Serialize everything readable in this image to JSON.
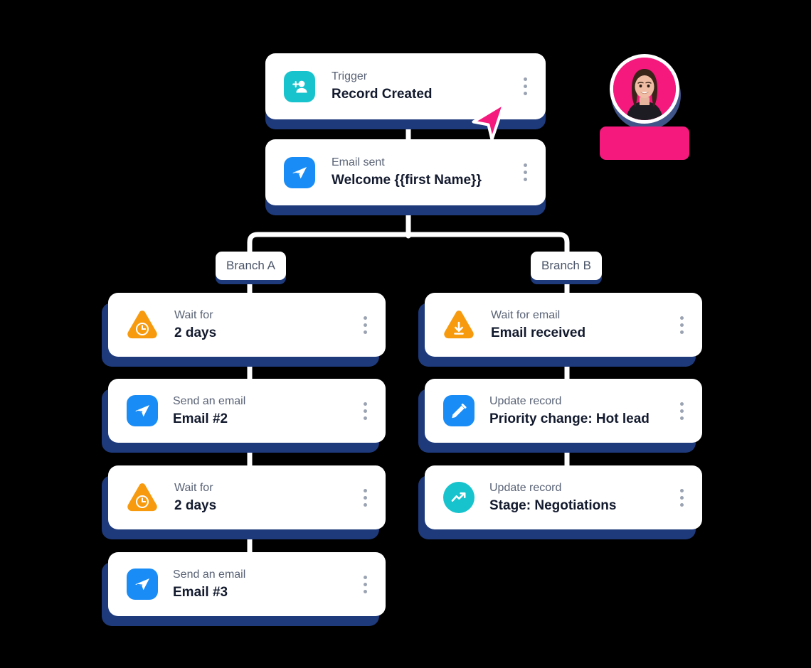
{
  "colors": {
    "background": "#000000",
    "card_bg": "#ffffff",
    "card_shadow": "#1e3a7b",
    "connector": "#ffffff",
    "kicker_text": "#596275",
    "title_text": "#131a2e",
    "teal": "#17c3cd",
    "blue": "#1a8cf5",
    "orange": "#f79a0e",
    "pink": "#f5197e",
    "kebab_dot": "#9aa3b2",
    "branch_label_text": "#4a5468"
  },
  "flow": {
    "trigger": {
      "kicker": "Trigger",
      "title": "Record Created",
      "icon": "add-person-icon",
      "menu_icon": "kebab-menu-icon"
    },
    "email_sent": {
      "kicker": "Email sent",
      "title": "Welcome {{first Name}}",
      "icon": "send-email-icon",
      "menu_icon": "kebab-menu-icon"
    },
    "branches": [
      {
        "label": "Branch A"
      },
      {
        "label": "Branch B"
      }
    ],
    "branch_a_steps": [
      {
        "kicker": "Wait for",
        "title": "2 days",
        "icon": "clock-warning-icon",
        "menu_icon": "kebab-menu-icon"
      },
      {
        "kicker": "Send an email",
        "title": "Email #2",
        "icon": "send-email-icon",
        "menu_icon": "kebab-menu-icon"
      },
      {
        "kicker": "Wait for",
        "title": "2 days",
        "icon": "clock-warning-icon",
        "menu_icon": "kebab-menu-icon"
      },
      {
        "kicker": "Send an email",
        "title": "Email #3",
        "icon": "send-email-icon",
        "menu_icon": "kebab-menu-icon"
      }
    ],
    "branch_b_steps": [
      {
        "kicker": "Wait for email",
        "title": "Email received",
        "icon": "download-warning-icon",
        "menu_icon": "kebab-menu-icon"
      },
      {
        "kicker": "Update record",
        "title": "Priority change: Hot lead",
        "icon": "pencil-edit-icon",
        "menu_icon": "kebab-menu-icon"
      },
      {
        "kicker": "Update record",
        "title": "Stage: Negotiations",
        "icon": "trending-up-icon",
        "menu_icon": "kebab-menu-icon"
      }
    ]
  },
  "collaborator": {
    "avatar_icon": "user-avatar-photo",
    "name_tag_label": ""
  },
  "pointer": {
    "cursor_icon": "mouse-cursor-icon"
  }
}
